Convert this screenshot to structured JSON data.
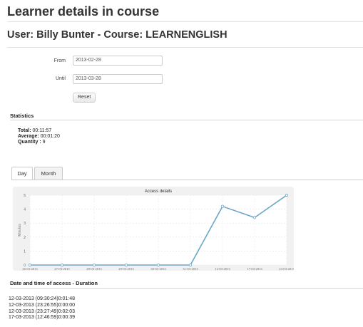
{
  "page": {
    "title": "Learner details in course",
    "subtitle": "User: Billy Bunter - Course: LEARNENGLISH"
  },
  "filters": {
    "from_label": "From",
    "from_value": "2013-02-28",
    "until_label": "Until",
    "until_value": "2013-03-28",
    "reset_label": "Reset"
  },
  "statistics": {
    "heading": "Statistics",
    "total_label": "Total:",
    "total_value": "00:11:57",
    "average_label": "Average:",
    "average_value": "00:01:20",
    "quantity_label": "Quantity :",
    "quantity_value": "9"
  },
  "tabs": [
    {
      "label": "Day",
      "active": true
    },
    {
      "label": "Month",
      "active": false
    }
  ],
  "chart_data": {
    "type": "line",
    "title": "Access details",
    "xlabel": "",
    "ylabel": "Minutes",
    "categories": [
      "26-03-2013",
      "27-03-2013",
      "28-03-2013",
      "29-03-2013",
      "30-03-2013",
      "31-03-2013",
      "12-03-2013",
      "17-03-2013",
      "23-03-2013"
    ],
    "series": [
      {
        "values": [
          0,
          0,
          0,
          0,
          0,
          0,
          4.2,
          3.4,
          5.0
        ]
      }
    ],
    "y_ticks": [
      0,
      1,
      2,
      3,
      4,
      5
    ],
    "ylim": [
      0,
      5
    ],
    "grid": true,
    "colors": {
      "line": "#6aa6c8",
      "background": "#f1f1f1",
      "plot": "#ffffff"
    }
  },
  "access": {
    "heading": "Date and time of access - Duration",
    "entries": [
      "12-03-2013 (09:30:24)0:01:48",
      "12-03-2013 (23:26:55)0:00:00",
      "12-03-2013 (23:27:49)0:02:03",
      "17-03-2013 (12:46:59)0:00:39"
    ]
  }
}
